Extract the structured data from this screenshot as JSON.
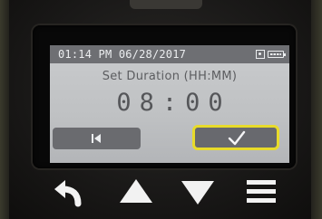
{
  "status_bar": {
    "datetime": "01:14 PM 06/28/2017",
    "settings_icon": "settings-icon",
    "battery_icon": "battery-icon"
  },
  "screen": {
    "title": "Set Duration (HH:MM)",
    "duration": "08:00"
  },
  "softkeys": {
    "back": {
      "icon": "skip-to-start-icon"
    },
    "confirm": {
      "icon": "check-icon",
      "highlight_color": "#e8db2a"
    }
  },
  "hardware_buttons": [
    {
      "name": "back",
      "icon": "return-arrow-icon"
    },
    {
      "name": "up",
      "icon": "triangle-up-icon"
    },
    {
      "name": "down",
      "icon": "triangle-down-icon"
    },
    {
      "name": "menu",
      "icon": "menu-icon"
    }
  ],
  "colors": {
    "status_bar_bg": "#6e6f73",
    "screen_bg": "#c4c6c8",
    "button_bg": "#68696e",
    "hardware_icon": "#f2f2f2",
    "selection_outline": "#e8db2a"
  }
}
